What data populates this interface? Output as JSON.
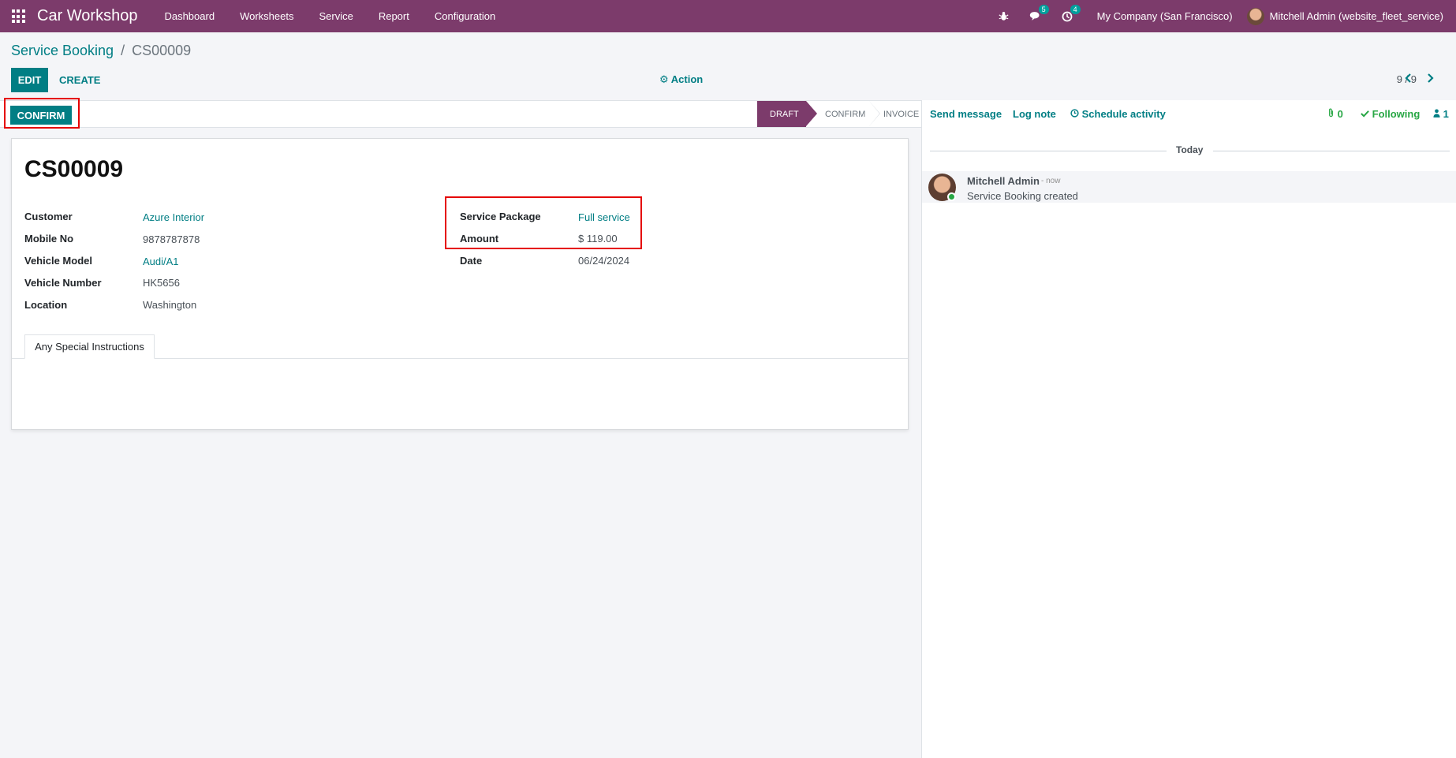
{
  "navbar": {
    "brand": "Car Workshop",
    "menu": [
      "Dashboard",
      "Worksheets",
      "Service",
      "Report",
      "Configuration"
    ],
    "messages_count": "5",
    "activities_count": "4",
    "company": "My Company (San Francisco)",
    "user": "Mitchell Admin (website_fleet_service)"
  },
  "breadcrumb": {
    "parent": "Service Booking",
    "separator": "/",
    "current": "CS00009"
  },
  "control": {
    "edit": "EDIT",
    "create": "CREATE",
    "action": "Action",
    "pager": "9 / 9"
  },
  "statusbar": {
    "confirm_button": "CONFIRM",
    "stages": [
      "DRAFT",
      "CONFIRM",
      "INVOICE"
    ],
    "active_stage": "DRAFT"
  },
  "record": {
    "name": "CS00009",
    "left_fields": [
      {
        "label": "Customer",
        "value": "Azure Interior",
        "link": true
      },
      {
        "label": "Mobile No",
        "value": "9878787878",
        "link": false
      },
      {
        "label": "Vehicle Model",
        "value": "Audi/A1",
        "link": true
      },
      {
        "label": "Vehicle Number",
        "value": "HK5656",
        "link": false
      },
      {
        "label": "Location",
        "value": "Washington",
        "link": false
      }
    ],
    "right_fields": [
      {
        "label": "Service Package",
        "value": "Full service",
        "link": true
      },
      {
        "label": "Amount",
        "value": "$ 119.00",
        "link": false
      },
      {
        "label": "Date",
        "value": "06/24/2024",
        "link": false
      }
    ],
    "tab": "Any Special Instructions"
  },
  "chatter": {
    "send_message": "Send message",
    "log_note": "Log note",
    "schedule_activity": "Schedule activity",
    "attachments": "0",
    "following": "Following",
    "followers": "1",
    "today": "Today",
    "message": {
      "author": "Mitchell Admin",
      "time": "- now",
      "body": "Service Booking created"
    }
  },
  "colors": {
    "navbar": "#7c3b6b",
    "primary": "#017e84",
    "highlight": "#e50000",
    "following": "#28a745"
  }
}
